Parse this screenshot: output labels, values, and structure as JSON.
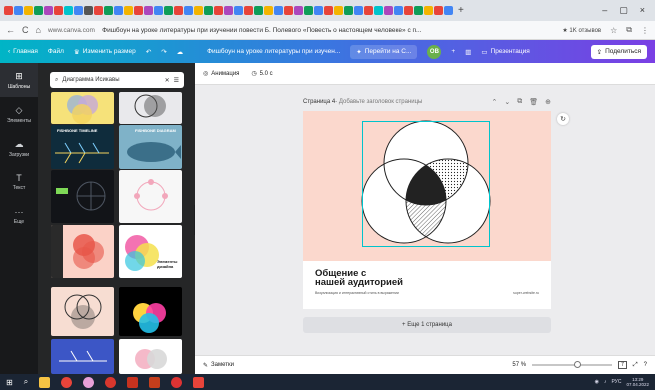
{
  "browser": {
    "tab_title": "Фишбоун на уроке литературы при изучении повести Б. Полевого «Повесть о настоящем человеке» с п...",
    "tab_close": "×",
    "new_tab": "+",
    "window_controls": {
      "minimize": "–",
      "maximize": "▢",
      "close": "×"
    },
    "nav": {
      "back": "←",
      "reload": "C",
      "home": "⌂"
    },
    "url_host": "www.canva.com",
    "url_title": "Фишбоун на уроке литературы при изучении повести Б. Полевого «Повесть о настоящем человеке» с п...",
    "reviews": "★ 1K отзывов"
  },
  "toolbar": {
    "home": "Главная",
    "file": "Файл",
    "resize": "Изменить размер",
    "doc_title": "Фишбоун на уроке литературы при изучен...",
    "go_to": "Перейти на C...",
    "avatar": "OB",
    "present": "Презентация",
    "share": "Поделиться",
    "accent": "#00c4cc"
  },
  "rail": [
    {
      "label": "Шаблоны",
      "icon": "⊞"
    },
    {
      "label": "Элементы",
      "icon": "◇"
    },
    {
      "label": "Загрузки",
      "icon": "☁"
    },
    {
      "label": "Текст",
      "icon": "T"
    },
    {
      "label": "Еще",
      "icon": "···"
    }
  ],
  "panel": {
    "search_value": "Диаграмма Исикавы",
    "templates": [
      {
        "caption": ""
      },
      {
        "caption": ""
      },
      {
        "caption": "FISHBONE TIMELINE"
      },
      {
        "caption": "FISHBONE DIAGRAM"
      },
      {
        "caption": ""
      },
      {
        "caption": ""
      },
      {
        "caption": ""
      },
      {
        "caption": "Элементы дизайна"
      },
      {
        "caption": ""
      },
      {
        "caption": ""
      },
      {
        "caption": ""
      },
      {
        "caption": ""
      }
    ]
  },
  "canvas": {
    "animation": "Анимация",
    "duration": "5.0 с",
    "page_label": "Страница 4",
    "page_hint": " - Добавьте заголовок страницы",
    "page_title_line1": "Общение с",
    "page_title_line2": "нашей аудиторией",
    "page_subtitle": "Визуализация и интерактивный стиль в выражении",
    "page_brand": "super-website.ru",
    "add_page": "+ Еще 1 страница"
  },
  "status": {
    "notes": "Заметки",
    "zoom": "57 %",
    "zoom_fraction": 0.57,
    "page_num": "7"
  },
  "taskbar": {
    "lang": "РУС",
    "time": "13:29",
    "date": "07.04.2022"
  }
}
